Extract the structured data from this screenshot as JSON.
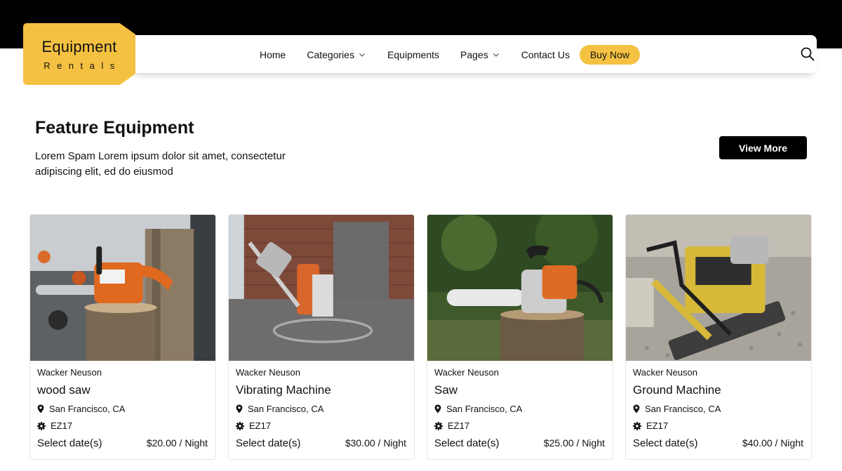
{
  "header": {
    "logo": {
      "title": "Equipment",
      "subtitle": "Rentals"
    },
    "nav": {
      "home": "Home",
      "categories": "Categories",
      "equipments": "Equipments",
      "pages": "Pages",
      "contact": "Contact Us"
    },
    "buy_now": "Buy Now",
    "search_icon": "search-icon"
  },
  "section": {
    "title": "Feature Equipment",
    "description": "Lorem Spam Lorem ipsum dolor sit amet, consectetur adipiscing elit, ed do eiusmod",
    "view_more": "View More"
  },
  "cards": [
    {
      "brand": "Wacker Neuson",
      "name": "wood saw",
      "location": "San Francisco, CA",
      "code": "EZ17",
      "select_label": "Select date(s)",
      "price": "$20.00 / Night"
    },
    {
      "brand": "Wacker Neuson",
      "name": "Vibrating Machine",
      "location": "San Francisco, CA",
      "code": "EZ17",
      "select_label": "Select date(s)",
      "price": "$30.00 / Night"
    },
    {
      "brand": "Wacker Neuson",
      "name": "Saw",
      "location": "San Francisco, CA",
      "code": "EZ17",
      "select_label": "Select date(s)",
      "price": "$25.00 / Night"
    },
    {
      "brand": "Wacker Neuson",
      "name": "Ground Machine",
      "location": "San Francisco, CA",
      "code": "EZ17",
      "select_label": "Select date(s)",
      "price": "$40.00 / Night"
    }
  ],
  "colors": {
    "accent": "#f5c142",
    "topbar": "#000000",
    "button_dark": "#000000"
  }
}
